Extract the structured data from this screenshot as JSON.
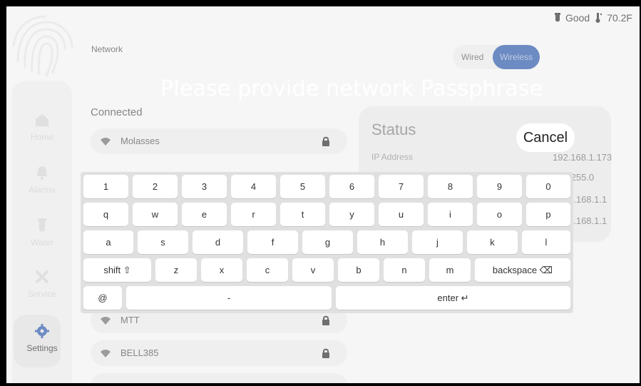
{
  "status": {
    "signal": "Good",
    "temperature": "70.2F"
  },
  "page": {
    "title": "Network"
  },
  "toggle": {
    "wired": "Wired",
    "wireless": "Wireless"
  },
  "sidebar": {
    "items": [
      {
        "label": "Home",
        "icon": "home-icon"
      },
      {
        "label": "Alarms",
        "icon": "bell-icon"
      },
      {
        "label": "Water",
        "icon": "water-tube-icon"
      },
      {
        "label": "Service",
        "icon": "tools-icon"
      },
      {
        "label": "Settings",
        "icon": "gear-icon"
      }
    ]
  },
  "connected": {
    "label": "Connected",
    "network": "Molasses"
  },
  "networks": [
    {
      "name": "MTT"
    },
    {
      "name": "BELL385"
    }
  ],
  "status_panel": {
    "title": "Status",
    "ip_label": "IP Address",
    "ip_value": "192.168.1.173",
    "rows": [
      ".255.0",
      "2.168.1.1",
      "2.168.1.1"
    ]
  },
  "prompt": "Please provide network Passphrase",
  "cancel": "Cancel",
  "keyboard": {
    "row1": [
      "1",
      "2",
      "3",
      "4",
      "5",
      "6",
      "7",
      "8",
      "9",
      "0"
    ],
    "row2": [
      "q",
      "w",
      "e",
      "r",
      "t",
      "y",
      "u",
      "i",
      "o",
      "p"
    ],
    "row3": [
      "a",
      "s",
      "d",
      "f",
      "g",
      "h",
      "j",
      "k",
      "l"
    ],
    "row4": [
      "shift ⇧",
      "z",
      "x",
      "c",
      "v",
      "b",
      "n",
      "m",
      "backspace ⌫"
    ],
    "row5": [
      "@",
      "-",
      "enter ↵"
    ]
  },
  "colors": {
    "accent": "#1f4ea3",
    "background": "#f1f1f1"
  }
}
